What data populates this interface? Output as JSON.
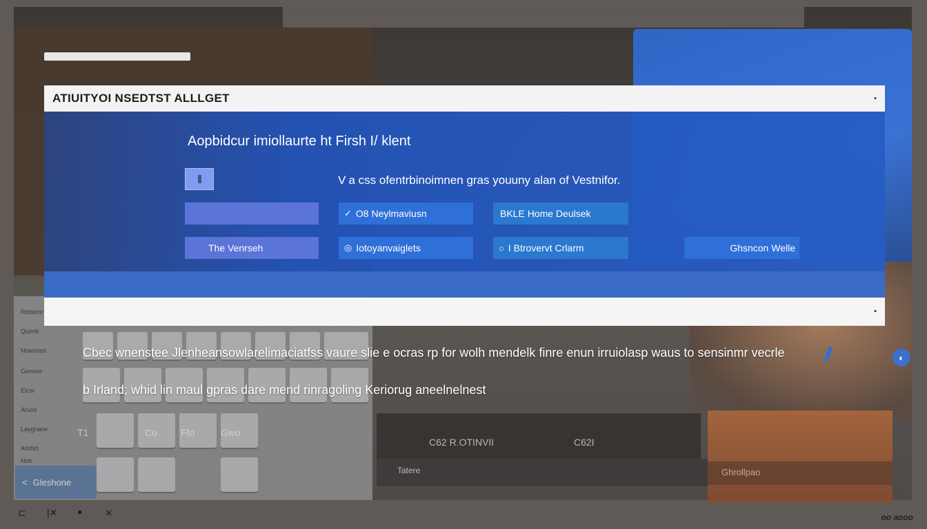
{
  "window": {
    "title": "ATIUITYOI NSEDTST ALLLGET",
    "corner_mark": "▪"
  },
  "dialog": {
    "heading": "Aopbidcur imiollaurte ht Firsh I/ klent",
    "description_prefix": "V",
    "description": " a  css  ofentrbinoimnen  gras  youuny  alan  of  Vestnifor.",
    "options": [
      {
        "label": "",
        "icon": ""
      },
      {
        "label": "O8 Neylmaviusn",
        "icon": "✓"
      },
      {
        "label": "BKLE Home Deulsek",
        "icon": ""
      },
      {
        "label": "The Venrseh",
        "icon": ""
      },
      {
        "label": "Iotoyanvaiglets",
        "icon": "◎"
      },
      {
        "label": "I Btrovervt Crlarm",
        "icon": "○"
      },
      {
        "label": "Ghsncon Welle",
        "icon": ""
      }
    ],
    "footer_mark": "▪"
  },
  "body": {
    "line1": "Cbec wnenstee Jlenheansowlarelimaciatfss vaure slie e ocras rp for wolh mendelk finre enun irruiolasp waus to sensinmr vecrle",
    "line2": "b Irland; whid lin maul gpras dare mend rinragoling Keriorug aneelnelnest"
  },
  "background": {
    "side_labels": [
      "Quirnk",
      "Nowsnos",
      "Gensve",
      "Elcsr",
      "Aruos",
      "Laygnaov",
      "Arbfsh",
      "Rotiwmr",
      "Nntr"
    ],
    "key_labels": [
      "T1",
      "Co",
      "Ffo",
      "Gwo"
    ],
    "lower_labels": [
      "C62  R.OTINVII",
      "C62I",
      "Tatere",
      "Ghrollpao"
    ],
    "cancel_label": "Gleshone",
    "brand": "oo aooo"
  },
  "toolbar": {
    "icons": [
      "window-icon",
      "close-icon",
      "user-icon",
      "swap-icon"
    ],
    "glyphs": [
      "⊏",
      "|✕",
      "●",
      "⨯"
    ]
  },
  "colors": {
    "dialog_blue": "#2154bd",
    "title_bar": "#f3f3f3",
    "accent": "#2f6fd8"
  }
}
